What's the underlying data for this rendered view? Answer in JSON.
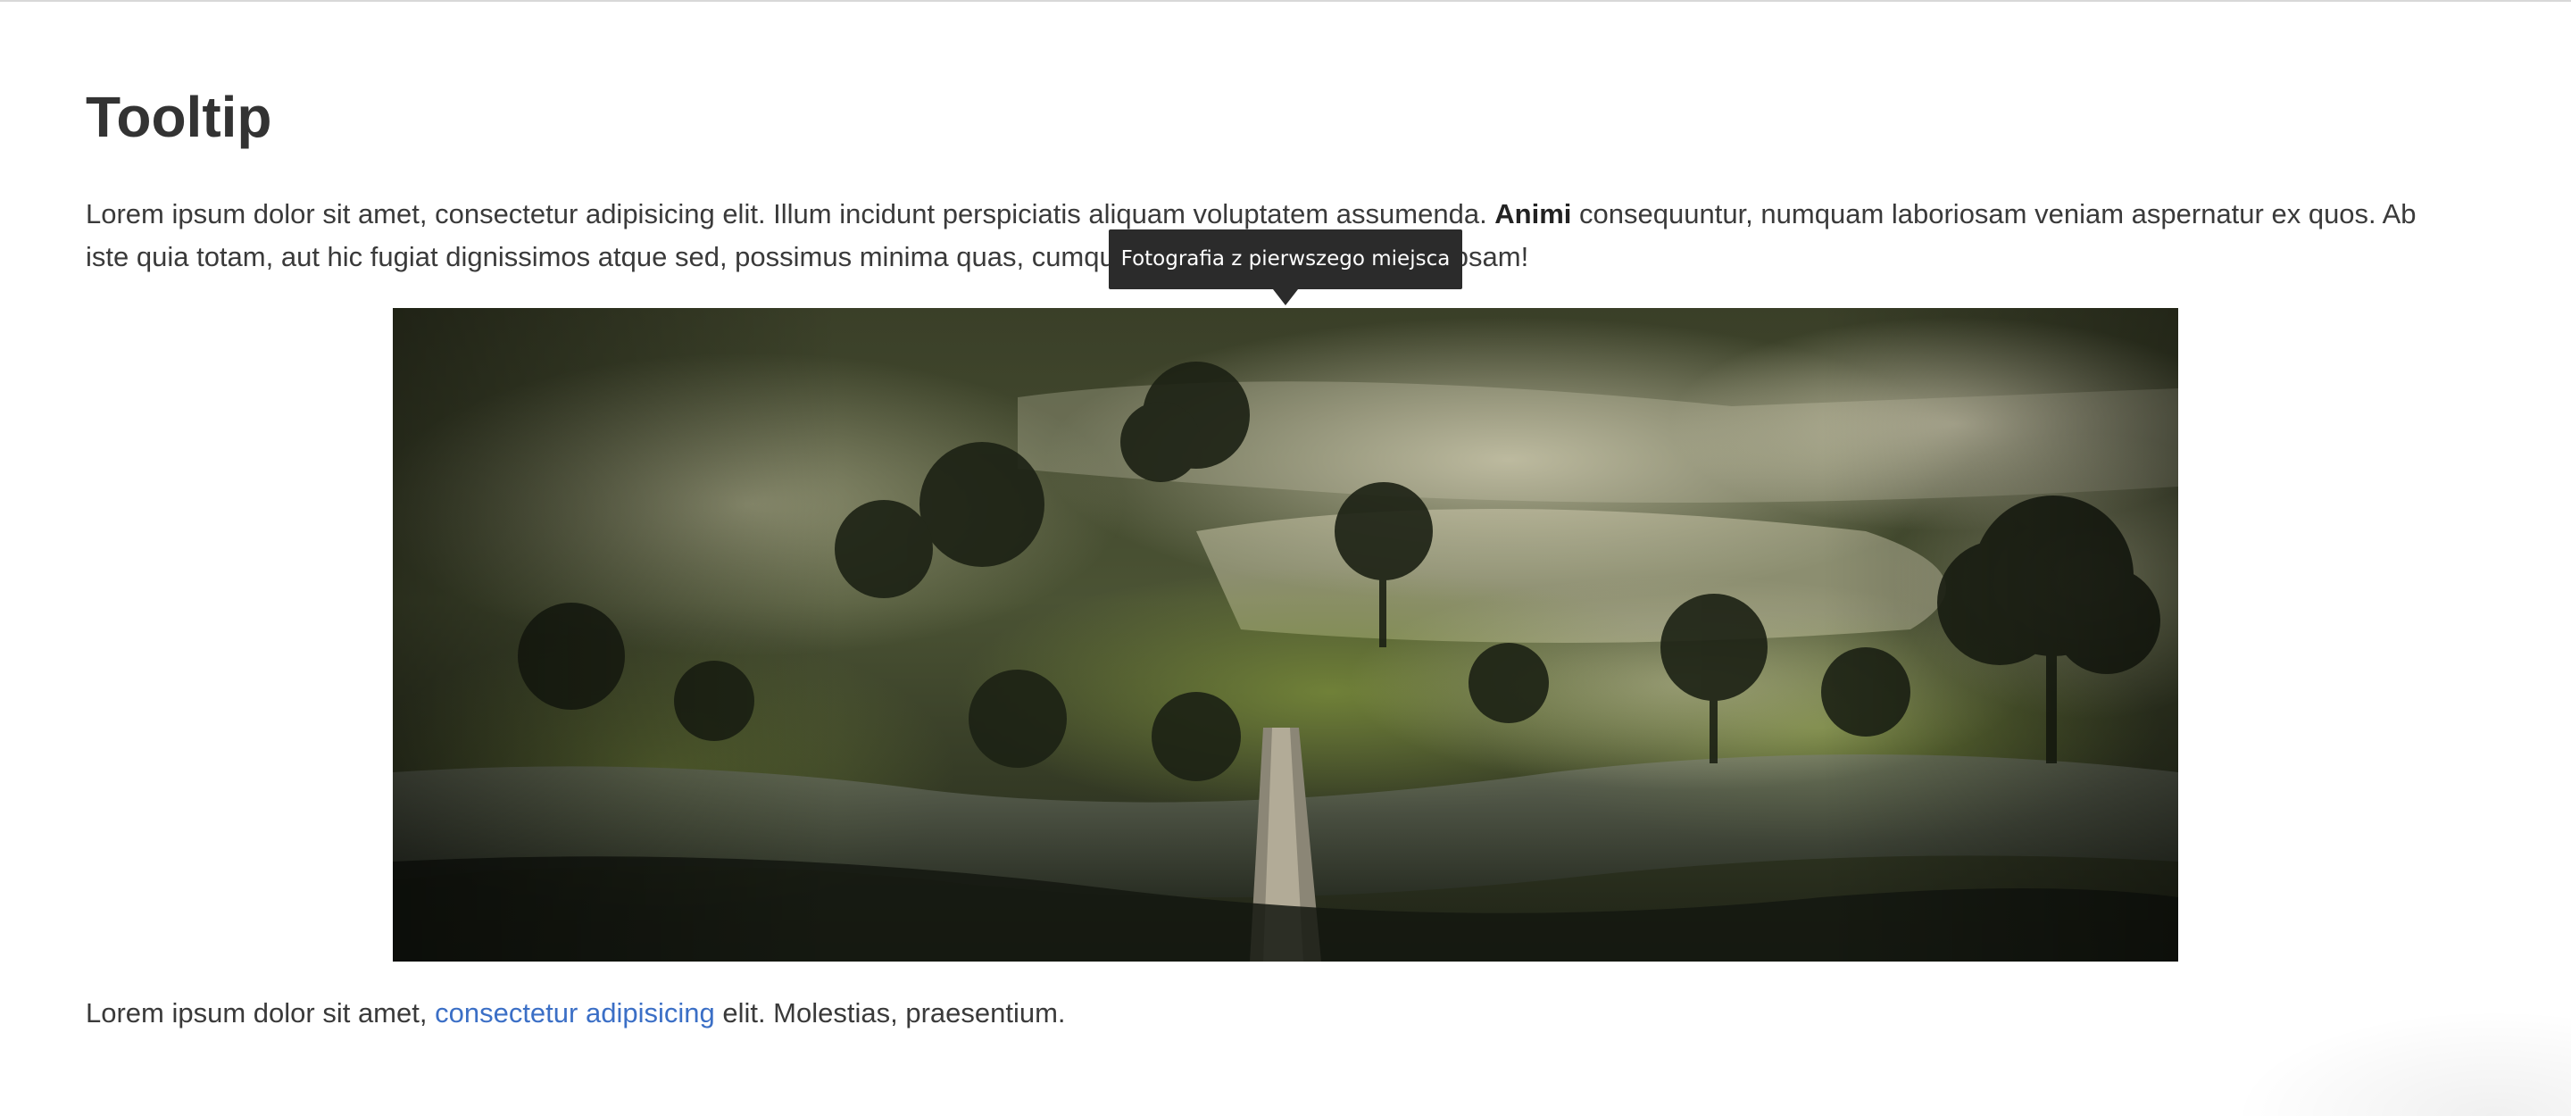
{
  "page": {
    "title": "Tooltip"
  },
  "intro": {
    "text_before_bold": "Lorem ipsum dolor sit amet, consectetur adipisicing elit. Illum incidunt perspiciatis aliquam voluptatem assumenda. ",
    "bold": "Animi",
    "text_after_bold": " consequuntur, numquam laboriosam veniam aspernatur ex quos. Ab iste quia totam, aut hic fugiat dignissimos atque sed, possimus minima quas, cumque quam nostrum! Quis, est ipsam!"
  },
  "tooltip": {
    "text": "Fotografia z pierwszego miejsca"
  },
  "outro": {
    "text_before_link": "Lorem ipsum dolor sit amet, ",
    "link": "consectetur adipisicing",
    "text_after_link": " elit. Molestias, praesentium."
  },
  "colors": {
    "heading": "#333333",
    "body_text": "#3a3a3a",
    "link": "#3b6fc6",
    "tooltip_bg": "#2b2b2b",
    "tooltip_text": "#ffffff"
  }
}
